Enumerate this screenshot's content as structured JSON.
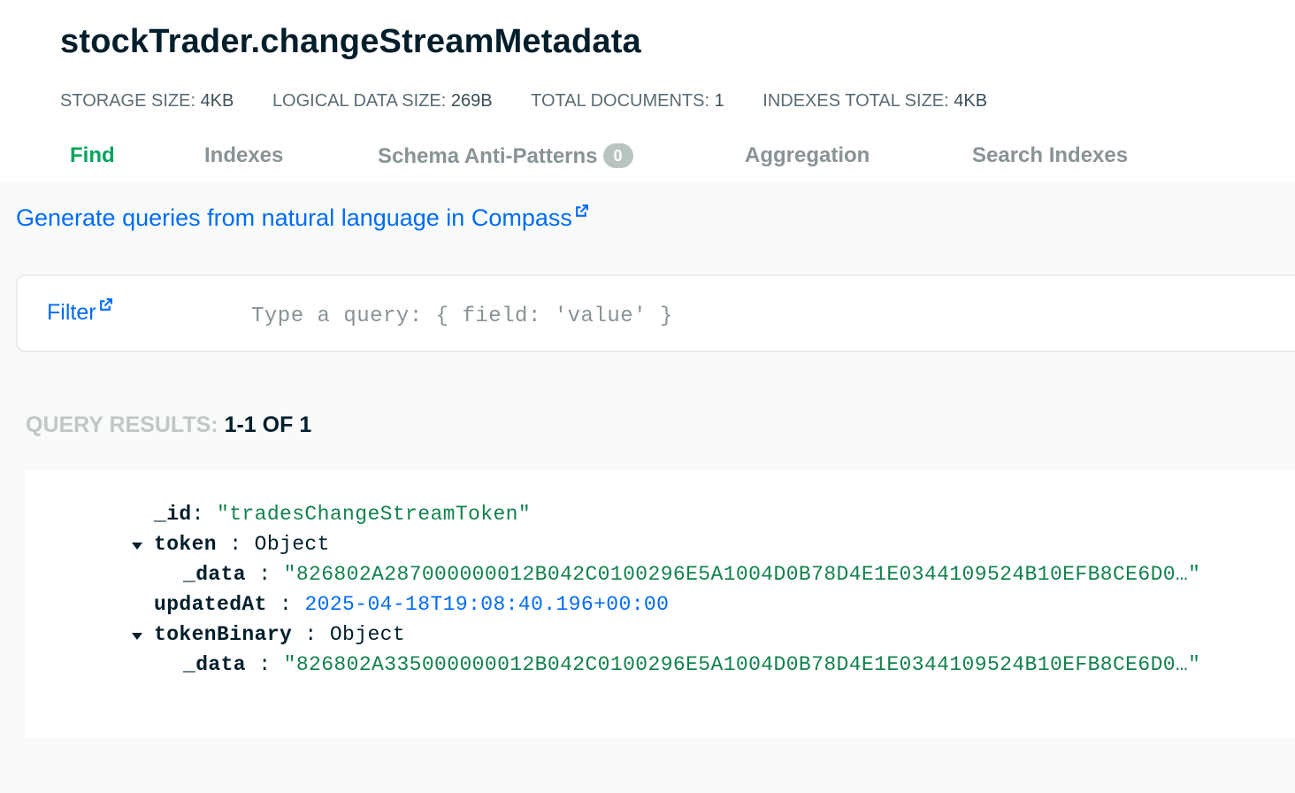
{
  "collection": {
    "title": "stockTrader.changeStreamMetadata"
  },
  "stats": [
    {
      "label": "STORAGE SIZE:",
      "value": "4KB"
    },
    {
      "label": "LOGICAL DATA SIZE:",
      "value": "269B"
    },
    {
      "label": "TOTAL DOCUMENTS:",
      "value": "1"
    },
    {
      "label": "INDEXES TOTAL SIZE:",
      "value": "4KB"
    }
  ],
  "tabs": [
    {
      "label": "Find",
      "active": true
    },
    {
      "label": "Indexes"
    },
    {
      "label": "Schema Anti-Patterns",
      "badge": "0"
    },
    {
      "label": "Aggregation"
    },
    {
      "label": "Search Indexes"
    }
  ],
  "nl_query_link": "Generate queries from natural language in Compass",
  "filter": {
    "label": "Filter",
    "value": "",
    "placeholder": "Type a query: { field: 'value' }"
  },
  "results": {
    "label": "QUERY RESULTS:",
    "range": "1-1 OF 1"
  },
  "document": {
    "id_key": "_id",
    "id_value": "\"tradesChangeStreamToken\"",
    "token_key": "token",
    "token_type": "Object",
    "token_data_key": "_data",
    "token_data_value": "\"826802A287000000012B042C0100296E5A1004D0B78D4E1E0344109524B10EFB8CE6D0…\"",
    "updated_key": "updatedAt",
    "updated_value": "2025-04-18T19:08:40.196+00:00",
    "binary_key": "tokenBinary",
    "binary_type": "Object",
    "binary_data_key": "_data",
    "binary_data_value": "\"826802A335000000012B042C0100296E5A1004D0B78D4E1E0344109524B10EFB8CE6D0…\""
  },
  "colors": {
    "accent_green": "#00a35c",
    "link_blue": "#016bf8",
    "string_green": "#12824d",
    "text_dark": "#001e2b"
  },
  "icons": [
    "external-link-icon",
    "caret-down-icon"
  ]
}
